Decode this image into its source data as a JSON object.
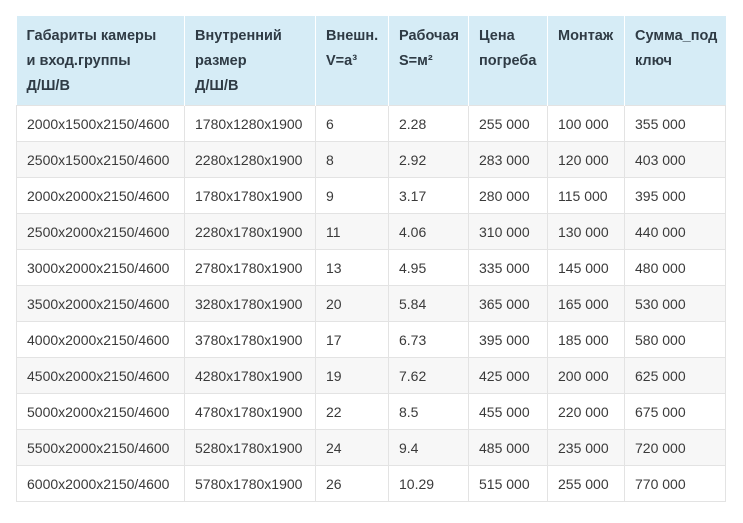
{
  "table": {
    "headers": [
      [
        "Габариты камеры",
        "и вход.группы",
        "Д/Ш/В"
      ],
      [
        "Внутренний",
        "размер",
        "Д/Ш/В"
      ],
      [
        "Внешн.",
        "V=a³",
        ""
      ],
      [
        "Рабочая",
        "S=м²",
        ""
      ],
      [
        "Цена",
        "погреба",
        ""
      ],
      [
        "Монтаж",
        "",
        ""
      ],
      [
        "Сумма_под",
        "ключ",
        ""
      ]
    ],
    "rows": [
      [
        "2000х1500х2150/4600",
        "1780х1280х1900",
        "6",
        "2.28",
        "255 000",
        "100 000",
        "355 000"
      ],
      [
        "2500х1500х2150/4600",
        "2280х1280х1900",
        "8",
        "2.92",
        "283 000",
        "120 000",
        "403 000"
      ],
      [
        "2000х2000х2150/4600",
        "1780х1780х1900",
        "9",
        "3.17",
        "280 000",
        "115 000",
        "395 000"
      ],
      [
        "2500х2000х2150/4600",
        "2280х1780х1900",
        "11",
        "4.06",
        "310 000",
        "130 000",
        "440 000"
      ],
      [
        "3000х2000х2150/4600",
        "2780х1780х1900",
        "13",
        "4.95",
        "335 000",
        "145 000",
        "480 000"
      ],
      [
        "3500х2000х2150/4600",
        "3280х1780х1900",
        "20",
        "5.84",
        "365 000",
        "165 000",
        "530 000"
      ],
      [
        "4000х2000х2150/4600",
        "3780х1780х1900",
        "17",
        "6.73",
        "395 000",
        "185 000",
        "580 000"
      ],
      [
        "4500х2000х2150/4600",
        "4280х1780х1900",
        "19",
        "7.62",
        "425 000",
        "200 000",
        "625 000"
      ],
      [
        "5000х2000х2150/4600",
        "4780х1780х1900",
        "22",
        "8.5",
        "455 000",
        "220 000",
        "675 000"
      ],
      [
        "5500х2000х2150/4600",
        "5280х1780х1900",
        "24",
        "9.4",
        "485 000",
        "235 000",
        "720 000"
      ],
      [
        "6000х2000х2150/4600",
        "5780х1780х1900",
        "26",
        "10.29",
        "515 000",
        "255 000",
        "770 000"
      ]
    ]
  }
}
